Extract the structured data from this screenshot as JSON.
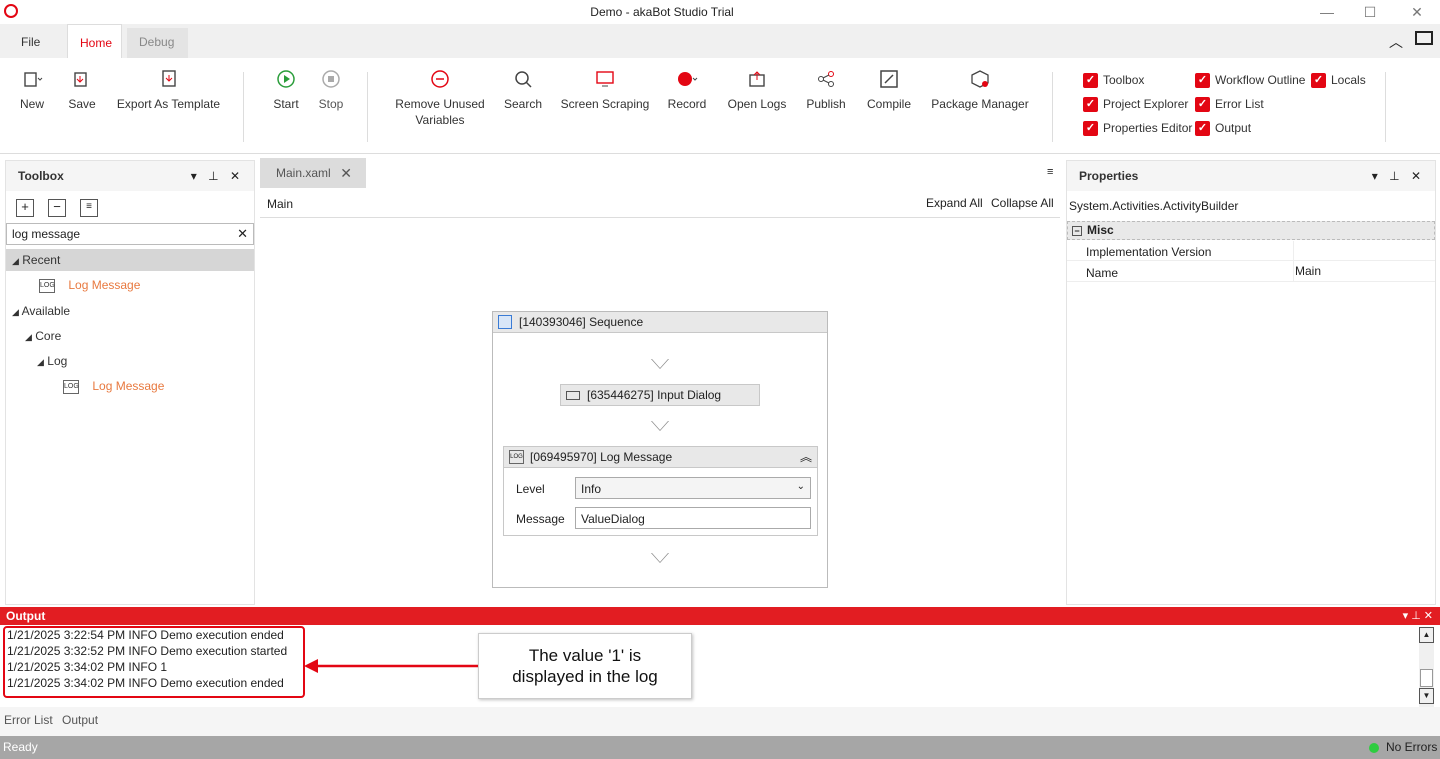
{
  "window": {
    "title": "Demo - akaBot Studio Trial"
  },
  "tabs": {
    "file": "File",
    "home": "Home",
    "debug": "Debug"
  },
  "ribbon": {
    "new": "New",
    "save": "Save",
    "export_template": "Export As Template",
    "start": "Start",
    "stop": "Stop",
    "remove_unused_1": "Remove Unused",
    "remove_unused_2": "Variables",
    "search": "Search",
    "screen_scraping": "Screen Scraping",
    "record": "Record",
    "open_logs": "Open Logs",
    "publish": "Publish",
    "compile": "Compile",
    "package_manager": "Package Manager"
  },
  "panels_toggle": {
    "toolbox": "Toolbox",
    "workflow_outline": "Workflow Outline",
    "locals": "Locals",
    "project_explorer": "Project Explorer",
    "error_list": "Error List",
    "properties_editor": "Properties Editor",
    "output": "Output"
  },
  "toolbox": {
    "title": "Toolbox",
    "search_value": "log message",
    "recent": "Recent",
    "recent_item": "Log Message",
    "available": "Available",
    "core": "Core",
    "log": "Log",
    "log_item": "Log Message"
  },
  "designer": {
    "tab": "Main.xaml",
    "breadcrumb": "Main",
    "expand_all": "Expand All",
    "collapse_all": "Collapse All",
    "sequence": "[140393046] Sequence",
    "input_dialog": "[635446275] Input Dialog",
    "log_message": "[069495970] Log Message",
    "level_label": "Level",
    "level_value": "Info",
    "message_label": "Message",
    "message_value": "ValueDialog"
  },
  "properties": {
    "title": "Properties",
    "type": "System.Activities.ActivityBuilder",
    "section": "Misc",
    "rows": [
      {
        "name": "Implementation Version",
        "value": ""
      },
      {
        "name": "Name",
        "value": "Main"
      }
    ]
  },
  "output": {
    "title": "Output",
    "lines": [
      "1/21/2025 3:22:54 PM INFO Demo execution ended",
      "1/21/2025 3:32:52 PM INFO Demo execution started",
      "1/21/2025 3:34:02 PM INFO 1",
      "1/21/2025 3:34:02 PM INFO Demo execution ended"
    ],
    "callout_1": "The value '1' is",
    "callout_2": "displayed in the log"
  },
  "bottom_tabs": {
    "error_list": "Error List",
    "output": "Output"
  },
  "status": {
    "left": "Ready",
    "right": "No Errors"
  },
  "colors": {
    "accent": "#e30613",
    "output_header": "#e21d22",
    "orange_item": "#e8793f",
    "status_ok": "#2ecc40"
  }
}
